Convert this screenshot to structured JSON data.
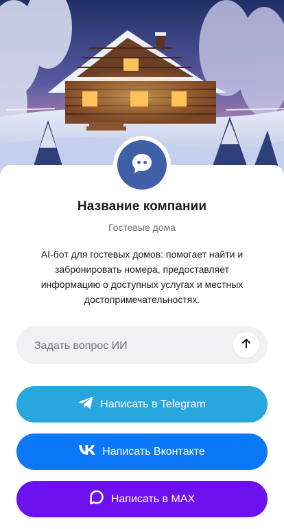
{
  "header": {
    "cover_image": "winter-log-cabin-illustration"
  },
  "profile": {
    "avatar_icon": "chat-bot-icon",
    "company_name": "Название компании",
    "subtitle": "Гостевые дома",
    "description": "AI-бот для гостевых домов: помогает найти и забронировать номера, предоставляет информацию о доступных услугах и местных достопримечательностях."
  },
  "ask": {
    "placeholder": "Задать вопрос ИИ",
    "value": "",
    "send_icon": "arrow-up-icon"
  },
  "buttons": [
    {
      "label": "Написать в Telegram",
      "icon": "telegram-icon",
      "color": "#28a6de"
    },
    {
      "label": "Написать Вконтакте",
      "icon": "vk-icon",
      "color": "#0b78f7"
    },
    {
      "label": "Написать в MAX",
      "icon": "max-icon",
      "color": "#6c10ee"
    }
  ],
  "colors": {
    "avatar_bg": "#3f5fa6",
    "input_bg": "#f1f1f3"
  }
}
